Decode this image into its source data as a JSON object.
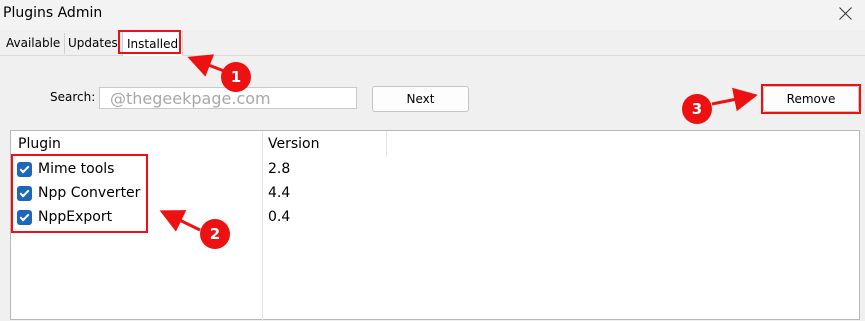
{
  "window": {
    "title": "Plugins Admin"
  },
  "tabs": [
    {
      "label": "Available"
    },
    {
      "label": "Updates"
    },
    {
      "label": "Installed",
      "active": true
    }
  ],
  "search": {
    "label": "Search:",
    "value": "@thegeekpage.com"
  },
  "buttons": {
    "next_label": "Next",
    "remove_label": "Remove"
  },
  "table": {
    "columns": [
      "Plugin",
      "Version"
    ],
    "rows": [
      {
        "name": "Mime tools",
        "version": "2.8",
        "checked": true
      },
      {
        "name": "Npp Converter",
        "version": "4.4",
        "checked": true
      },
      {
        "name": "NppExport",
        "version": "0.4",
        "checked": true
      }
    ]
  },
  "callouts": [
    "1",
    "2",
    "3"
  ],
  "colors": {
    "annotation_red": "#e11111",
    "checkbox_blue": "#1d67b8"
  }
}
